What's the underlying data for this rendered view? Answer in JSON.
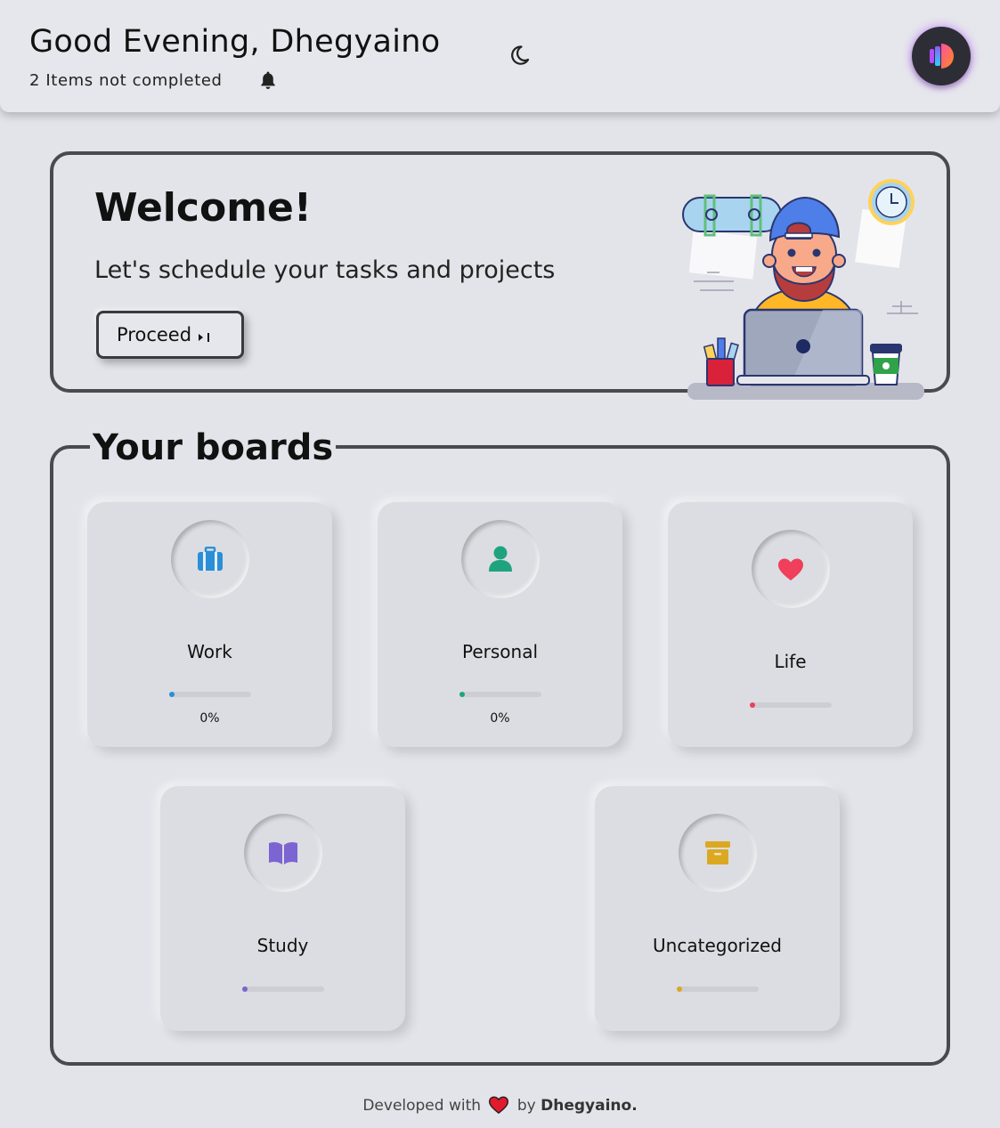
{
  "header": {
    "greeting": "Good Evening, Dhegyaino",
    "pending_count": "2",
    "pending_text": "Items not completed",
    "icons": {
      "notifications": "bell-icon",
      "theme_toggle": "moon-icon",
      "avatar": "app-logo"
    }
  },
  "welcome": {
    "title": "Welcome!",
    "subtitle": "Let's schedule your tasks and projects",
    "proceed_label": "Proceed",
    "illustration": "developer-at-laptop-illustration"
  },
  "boards": {
    "title": "Your boards",
    "items": [
      {
        "name": "Work",
        "icon": "briefcase-icon",
        "color": "#2a8fd6",
        "progress": 0,
        "percent_label": "0%"
      },
      {
        "name": "Personal",
        "icon": "user-icon",
        "color": "#1fa37f",
        "progress": 0,
        "percent_label": "0%"
      },
      {
        "name": "Life",
        "icon": "heart-icon",
        "color": "#ef3f5b",
        "progress": 0,
        "percent_label": ""
      },
      {
        "name": "Study",
        "icon": "book-icon",
        "color": "#7c64d2",
        "progress": 0,
        "percent_label": ""
      },
      {
        "name": "Uncategorized",
        "icon": "archive-box-icon",
        "color": "#dba822",
        "progress": 0,
        "percent_label": ""
      }
    ]
  },
  "footer": {
    "prefix": "Developed with",
    "by": "by",
    "author": "Dhegyaino."
  }
}
